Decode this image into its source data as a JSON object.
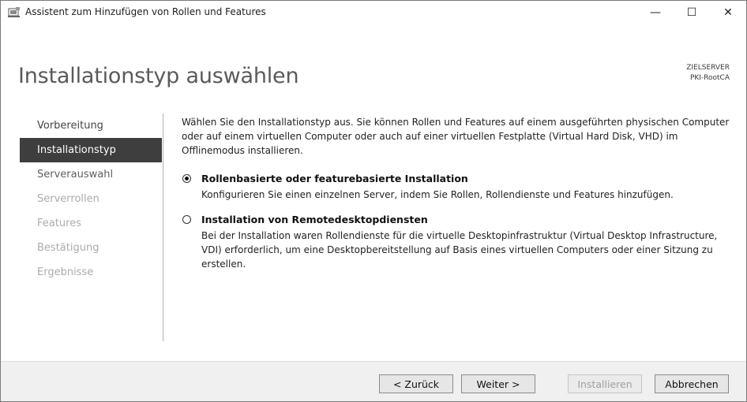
{
  "window": {
    "title": "Assistent zum Hinzufügen von Rollen und Features",
    "controls": {
      "minimize": "—",
      "maximize": "☐",
      "close": "✕"
    }
  },
  "header": {
    "title": "Installationstyp auswählen",
    "destination_label": "ZIELSERVER",
    "destination_server": "PKI-RootCA"
  },
  "nav": {
    "items": [
      {
        "label": "Vorbereitung",
        "state": "done"
      },
      {
        "label": "Installationstyp",
        "state": "active"
      },
      {
        "label": "Serverauswahl",
        "state": "next"
      },
      {
        "label": "Serverrollen",
        "state": "disabled"
      },
      {
        "label": "Features",
        "state": "disabled"
      },
      {
        "label": "Bestätigung",
        "state": "disabled"
      },
      {
        "label": "Ergebnisse",
        "state": "disabled"
      }
    ]
  },
  "content": {
    "intro": "Wählen Sie den Installationstyp aus. Sie können Rollen und Features auf einem ausgeführten physischen Computer oder auf einem virtuellen Computer oder auch auf einer virtuellen Festplatte (Virtual Hard Disk, VHD) im Offlinemodus installieren.",
    "options": [
      {
        "label": "Rollenbasierte oder featurebasierte Installation",
        "description": "Konfigurieren Sie einen einzelnen Server, indem Sie Rollen, Rollendienste und Features hinzufügen.",
        "selected": true
      },
      {
        "label": "Installation von Remotedesktopdiensten",
        "description": "Bei der Installation waren Rollendienste für die virtuelle Desktopinfrastruktur (Virtual Desktop Infrastructure, VDI) erforderlich, um eine Desktopbereitstellung auf Basis eines virtuellen Computers oder einer Sitzung zu erstellen.",
        "selected": false
      }
    ]
  },
  "footer": {
    "back": "< Zurück",
    "next": "Weiter >",
    "install": "Installieren",
    "cancel": "Abbrechen"
  },
  "colors": {
    "active_nav_bg": "#3e3e3e",
    "footer_bg": "#f0f0f0",
    "disabled_text": "#ababab"
  }
}
